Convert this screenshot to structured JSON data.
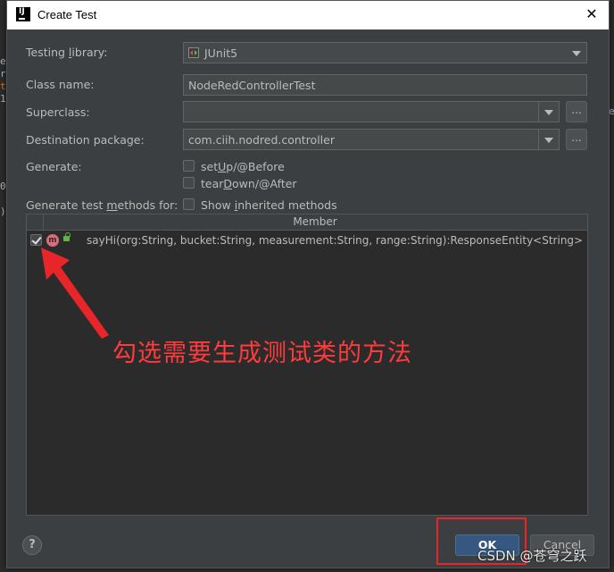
{
  "window": {
    "title": "Create Test"
  },
  "form": {
    "testing_library": {
      "label_pre": "Testing ",
      "label_mnemonic": "l",
      "label_post": "ibrary:",
      "value": "JUnit5",
      "icon": "junit-icon"
    },
    "class_name": {
      "label": "Class name:",
      "value": "NodeRedControllerTest"
    },
    "superclass": {
      "label": "Superclass:",
      "value": "",
      "browse_label": "..."
    },
    "destination_package": {
      "label": "Destination package:",
      "value": "com.ciih.nodred.controller",
      "browse_label": "..."
    },
    "generate": {
      "label": "Generate:",
      "setup": {
        "pre": "set",
        "mnemonic": "U",
        "post": "p/@Before",
        "checked": false
      },
      "teardown": {
        "pre": "tear",
        "mnemonic": "D",
        "post": "own/@After",
        "checked": false
      }
    },
    "methods_for": {
      "label_pre": "Generate test ",
      "label_mnemonic": "m",
      "label_post": "ethods for:"
    },
    "show_inherited": {
      "pre": "Show ",
      "mnemonic": "i",
      "post": "nherited methods",
      "checked": false
    }
  },
  "table": {
    "header": "Member",
    "rows": [
      {
        "checked": true,
        "icon_letter": "m",
        "signature": "sayHi(org:String, bucket:String, measurement:String, range:String):ResponseEntity<String>"
      }
    ]
  },
  "annotation": {
    "text": "勾选需要生成测试类的方法",
    "color": "#ff3b3b"
  },
  "buttons": {
    "help": "?",
    "ok": "OK",
    "cancel": "Cancel"
  },
  "watermark": "CSDN @苍穹之跃",
  "colors": {
    "dialog_bg": "#3c3f41",
    "accent": "#365880",
    "annotation": "#e8262a"
  }
}
